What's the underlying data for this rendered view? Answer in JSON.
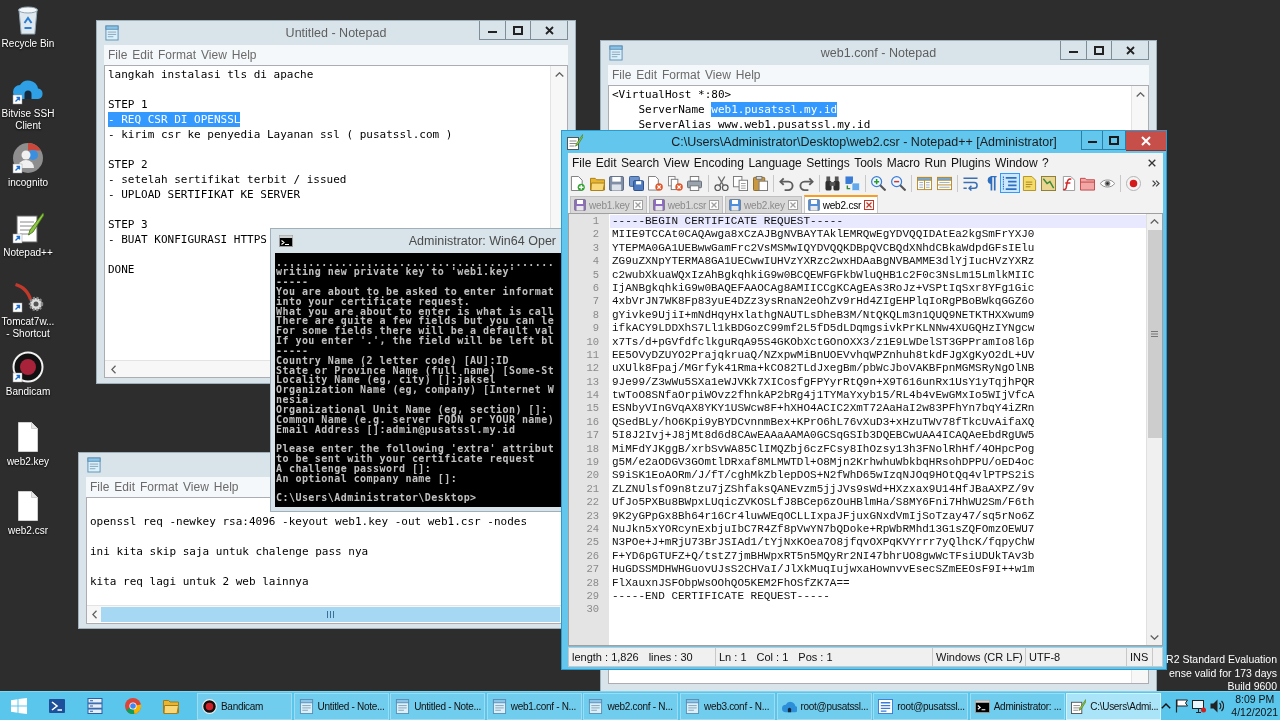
{
  "desktop_icons": [
    {
      "label": "Recycle Bin",
      "kind": "bin"
    },
    {
      "label": "Bitvise SSH Client",
      "kind": "cloud"
    },
    {
      "label": "incognito",
      "kind": "browser"
    },
    {
      "label": "Notepad++",
      "kind": "notebook"
    },
    {
      "label": "Tomcat7w... - Shortcut",
      "kind": "tool"
    },
    {
      "label": "Bandicam",
      "kind": "recorder"
    },
    {
      "label": "web2.key",
      "kind": "file"
    },
    {
      "label": "web2.csr",
      "kind": "file"
    }
  ],
  "notepad_steps": {
    "title": "Untitled - Notepad",
    "menu": [
      "File",
      "Edit",
      "Format",
      "View",
      "Help"
    ],
    "blocks": [
      {
        "lines": [
          {
            "text": "langkah instalasi tls di apache",
            "selected": false
          }
        ]
      },
      {
        "lines": [
          {
            "text": "STEP 1",
            "selected": false
          },
          {
            "text": "- REQ CSR DI OPENSSL",
            "selected": true
          },
          {
            "text": "- kirim csr ke penyedia Layanan ssl ( pusatssl.com )",
            "selected": false
          }
        ]
      },
      {
        "lines": [
          {
            "text": "STEP 2",
            "selected": false
          },
          {
            "text": "- setelah sertifikat terbit / issued",
            "selected": false
          },
          {
            "text": "- UPLOAD SERTIFIKAT KE SERVER",
            "selected": false
          }
        ]
      },
      {
        "lines": [
          {
            "text": "STEP 3",
            "selected": false
          },
          {
            "text": "- BUAT KONFIGURASI HTTPS",
            "selected": false
          }
        ]
      },
      {
        "lines": [
          {
            "text": "DONE",
            "selected": false
          }
        ]
      }
    ]
  },
  "notepad_conf": {
    "title": "web1.conf - Notepad",
    "menu": [
      "File",
      "Edit",
      "Format",
      "View",
      "Help"
    ],
    "lines": [
      {
        "segments": [
          {
            "text": "<VirtualHost *:80>",
            "selected": false
          }
        ],
        "children": [
          {
            "segments": [
              {
                "text": "ServerName ",
                "selected": false
              },
              {
                "text": "web1.pusatssl.my.id",
                "selected": true
              }
            ]
          },
          {
            "segments": [
              {
                "text": "ServerAlias www.web1.pusatssl.my.id",
                "selected": false
              }
            ]
          }
        ]
      }
    ]
  },
  "notepadpp": {
    "title": "C:\\Users\\Administrator\\Desktop\\web2.csr - Notepad++ [Administrator]",
    "menu": [
      "File",
      "Edit",
      "Search",
      "View",
      "Encoding",
      "Language",
      "Settings",
      "Tools",
      "Macro",
      "Run",
      "Plugins",
      "Window",
      "?"
    ],
    "toolbar": [
      [
        {
          "kind": "new",
          "pressed": false
        },
        {
          "kind": "open",
          "pressed": false
        },
        {
          "kind": "save",
          "pressed": false
        },
        {
          "kind": "saveall",
          "pressed": false
        },
        {
          "kind": "close",
          "pressed": false
        },
        {
          "kind": "closeall",
          "pressed": false
        },
        {
          "kind": "print",
          "pressed": false
        }
      ],
      [
        {
          "kind": "cut",
          "pressed": false
        },
        {
          "kind": "copy",
          "pressed": false
        },
        {
          "kind": "paste",
          "pressed": false
        }
      ],
      [
        {
          "kind": "undo",
          "pressed": false
        },
        {
          "kind": "redo",
          "pressed": false
        }
      ],
      [
        {
          "kind": "find",
          "pressed": false
        },
        {
          "kind": "replace",
          "pressed": false
        }
      ],
      [
        {
          "kind": "zoomin",
          "pressed": false
        },
        {
          "kind": "zoomout",
          "pressed": false
        }
      ],
      [
        {
          "kind": "syncv",
          "pressed": false
        },
        {
          "kind": "synch",
          "pressed": false
        }
      ],
      [
        {
          "kind": "wrap",
          "pressed": false
        },
        {
          "kind": "symbols",
          "pressed": false
        },
        {
          "kind": "indent",
          "pressed": true
        },
        {
          "kind": "language",
          "pressed": false
        },
        {
          "kind": "map",
          "pressed": false
        },
        {
          "kind": "functions",
          "pressed": false
        },
        {
          "kind": "folder",
          "pressed": false
        },
        {
          "kind": "monitor",
          "pressed": false
        }
      ],
      [
        {
          "kind": "record",
          "pressed": false
        }
      ]
    ],
    "tabs": [
      {
        "label": "web1.key",
        "selected": false,
        "color": "#8e6cc0"
      },
      {
        "label": "web1.csr",
        "selected": false,
        "color": "#8e6cc0"
      },
      {
        "label": "web2.key",
        "selected": false,
        "color": "#4f8fdc"
      },
      {
        "label": "web2.csr",
        "selected": true,
        "color": "#4f8fdc"
      }
    ],
    "lines": [
      {
        "number": "1",
        "text": "-----BEGIN CERTIFICATE REQUEST-----",
        "current": true
      },
      {
        "number": "2",
        "text": "MIIE9TCCAt0CAQAwga8xCzAJBgNVBAYTAklEMRQwEgYDVQQIDAtEa2kgSmFrYXJ0",
        "current": false
      },
      {
        "number": "3",
        "text": "YTEPMA0GA1UEBwwGamFrc2VsMSMwIQYDVQQKDBpQVCBQdXNhdCBkaWdpdGFsIElu",
        "current": false
      },
      {
        "number": "4",
        "text": "ZG9uZXNpYTERMA8GA1UECwwIUHVzYXRzc2wxHDAaBgNVBAMME3dlYjIucHVzYXRz",
        "current": false
      },
      {
        "number": "5",
        "text": "c2wubXkuaWQxIzAhBgkqhkiG9w0BCQEWFGFkbWluQHB1c2F0c3NsLm15LmlkMIIC",
        "current": false
      },
      {
        "number": "6",
        "text": "IjANBgkqhkiG9w0BAQEFAAOCAg8AMIICCgKCAgEAs3RoJz+VSPtIqSxr8YFg1Gic",
        "current": false
      },
      {
        "number": "7",
        "text": "4xbVrJN7WK8Fp83yuE4DZz3ysRnaN2eOhZv9rHd4ZIgEHPlqIoRgPBoBWkqGGZ6o",
        "current": false
      },
      {
        "number": "8",
        "text": "gYivke9UjiI+mNdHqyHxlathgNAUTLsDheB3M/NtQKQLm3n1QUQ9NETKTHXXwum9",
        "current": false
      },
      {
        "number": "9",
        "text": "ifkACY9LDDXhS7Ll1kBDGozC99mf2L5fD5dLDqmgsivkPrKLNNw4XUGQHzIYNgcw",
        "current": false
      },
      {
        "number": "10",
        "text": "x7Ts/d+pGVfdfclkguRqA95S4GKObXctGOnOXX3/z1E9LWDelST3GPPramIo8l6p",
        "current": false
      },
      {
        "number": "11",
        "text": "EE5OVyDZUYO2PrajqkruaQ/NZxpwMiBnUOEVvhqWPZnhuh8tkdFJgXgKyO2dL+UV",
        "current": false
      },
      {
        "number": "12",
        "text": "uXUlk8Fpaj/MGrfyk41Rma+kCO82TLdJxegBm/pbWcJboVAKBFpnMGMSRyNgOlNB",
        "current": false
      },
      {
        "number": "13",
        "text": "9Je99/Z3wWu5SXa1eWJVKk7XICosfgFPYyrRtQ9n+X9T616unRx1UsY1yTqjhPQR",
        "current": false
      },
      {
        "number": "14",
        "text": "twToO8SNfaOrpiWOvz2fhnkAP2bRg4j1TYMaYxyb15/RL4b4vEwGMxIo5WIjVfcA",
        "current": false
      },
      {
        "number": "15",
        "text": "ESNbyVInGVqAX8YKY1USWcw8F+hXHO4ACIC2XmT72AaHaI2w83PFhYn7bqY4iZRn",
        "current": false
      },
      {
        "number": "16",
        "text": "QSedBLy/hO6Kpi9yBYDCvnnmBex+KPrO6hL76vXuD3+xHzuTWv78fTkcUvAifaXQ",
        "current": false
      },
      {
        "number": "17",
        "text": "5I8J2Ivj+J8jMt8d6d8CAwEAAaAAMA0GCSqGSIb3DQEBCwUAA4ICAQAeEbdRgUW5",
        "current": false
      },
      {
        "number": "18",
        "text": "MiMFdYJKggB/xrbSvWA85ClIMQZbj6czFCsy8IhOzsy13h3FNolRhHf/4OHpcPog",
        "current": false
      },
      {
        "number": "19",
        "text": "g5M/e2aODGV3GOmtlDRxaf8MLMWTDl+O8Mjn2KrhwhuWbkbqHRsohDPPU/oED4oc",
        "current": false
      },
      {
        "number": "20",
        "text": "S9iSK1EoAORm/J/fT/cghMkZblepDOS+N2fWhD65wIzqNJOq9HOtQq4vlPTPS2iS",
        "current": false
      },
      {
        "number": "21",
        "text": "ZLZNUlsfO9n8tzu7jZShfaksQANEvzm5jjJVs9sWd+HXzxax9U14HfJBaAXPZ/9v",
        "current": false
      },
      {
        "number": "22",
        "text": "UfJo5PXBu8BWpxLUqicZVKOSLfJ8BCep6zOuHBlmHa/S8MY6Fni7HhWU2Sm/F6th",
        "current": false
      },
      {
        "number": "23",
        "text": "9K2yGPpGx8Bh64r16Cr4luwWEqOCLLIxpaJFjuxGNxdVmIjSoTzay47/sq5rNo6Z",
        "current": false
      },
      {
        "number": "24",
        "text": "NuJkn5xYORcynExbjuIbC7R4Zf8pVwYN7bQDoke+RpWbRMhd13G1sZQFOmzOEWU7",
        "current": false
      },
      {
        "number": "25",
        "text": "N3POe+J+mRjU73BrJSIAd1/tYjNxKOea7O8jfqvOXPqKVYrrr7yQlhcK/fqpyChW",
        "current": false
      },
      {
        "number": "26",
        "text": "F+YD6pGTUFZ+Q/tstZ7jmBHWpxRT5n5MQyRr2NI47bhrUO8gwWcTFsiUDUkTAv3b",
        "current": false
      },
      {
        "number": "27",
        "text": "HuGDSSMDHWHGuovUJsS2CHVaI/JlXkMuqIujwxaHownvvEsecSZmEEOsF9I++w1m",
        "current": false
      },
      {
        "number": "28",
        "text": "FlXauxnJSFObpWsOOhQO5KEM2FhOSfZK7A==",
        "current": false
      },
      {
        "number": "29",
        "text": "-----END CERTIFICATE REQUEST-----",
        "current": false
      },
      {
        "number": "30",
        "current": false
      }
    ],
    "status_bar": [
      {
        "items": [
          "length : 1,826",
          "lines : 30"
        ]
      },
      {
        "items": [
          "Ln : 1",
          "Col : 1",
          "Pos : 1"
        ]
      },
      {
        "items": [
          "Windows (CR LF)"
        ]
      },
      {
        "items": [
          "UTF-8"
        ]
      },
      {
        "items": [
          "INS"
        ]
      }
    ]
  },
  "console": {
    "title": "Administrator: Win64 Oper",
    "blocks": [
      {
        "lines": [
          "...........................................",
          "writing new private key to 'web1.key'",
          "-----",
          "You are about to be asked to enter informat",
          "into your certificate request.",
          "What you are about to enter is what is call",
          "There are quite a few fields but you can le",
          "For some fields there will be a default val",
          "If you enter '.', the field will be left bl",
          "-----",
          "Country Name (2 letter code) [AU]:ID",
          "State or Province Name (full name) [Some-St",
          "Locality Name (eg, city) []:jaksel",
          "Organization Name (eg, company) [Internet W",
          "nesia",
          "Organizational Unit Name (eg, section) []:",
          "Common Name (e.g. server FQDN or YOUR name)",
          "Email Address []:admin@pusatssl.my.id"
        ]
      },
      {
        "lines": [
          "Please enter the following 'extra' attribut",
          "to be sent with your certificate request",
          "A challenge password []:",
          "An optional company name []:"
        ]
      },
      {
        "lines": [
          "C:\\Users\\Administrator\\Desktop>"
        ]
      }
    ]
  },
  "notepad_commands": {
    "menu": [
      "File",
      "Edit",
      "Format",
      "View",
      "Help"
    ],
    "blocks": [
      {
        "lines": [
          {
            "text": "openssl req -newkey rsa:4096 -keyout web1.key -out web1.csr -nodes",
            "selected": false
          }
        ]
      },
      {
        "lines": [
          {
            "text": "ini kita skip saja untuk chalenge pass nya",
            "selected": false
          }
        ]
      },
      {
        "lines": [
          {
            "text": "kita req lagi untuk 2 web lainnya",
            "selected": false
          }
        ]
      }
    ]
  },
  "desktop_notice": [
    "R2 Standard Evaluation",
    "ense valid for 173 days",
    "Build 9600"
  ],
  "taskbar": {
    "tasks": [
      {
        "label": "Bandicam",
        "kind": "recorder",
        "selected": false
      },
      {
        "label": "Untitled - Note...",
        "kind": "notepad",
        "selected": false
      },
      {
        "label": "Untitled - Note...",
        "kind": "notepad",
        "selected": false
      },
      {
        "label": "web1.conf - N...",
        "kind": "notepad",
        "selected": false
      },
      {
        "label": "web2.conf - N...",
        "kind": "notepad",
        "selected": false
      },
      {
        "label": "web3.conf - N...",
        "kind": "notepad",
        "selected": false
      },
      {
        "label": "root@pusatssl...",
        "kind": "cloud",
        "selected": false
      },
      {
        "label": "root@pusatssl...",
        "kind": "sftp",
        "selected": false
      },
      {
        "label": "Administrator: ...",
        "kind": "console",
        "selected": false
      },
      {
        "label": "C:\\Users\\Admi...",
        "kind": "notepadpp",
        "selected": true
      }
    ],
    "clock": {
      "time": "8:09 PM",
      "date": "4/12/2021"
    }
  }
}
